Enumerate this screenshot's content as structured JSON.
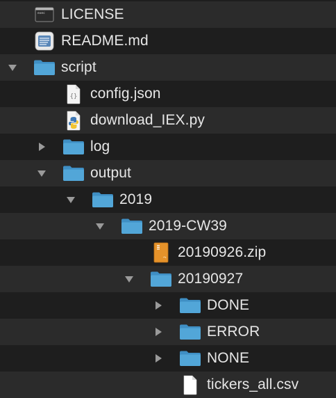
{
  "tree": [
    {
      "label": "LICENSE",
      "type": "file",
      "icon": "exec-document-icon",
      "depth": 0,
      "disclosure": "none"
    },
    {
      "label": "README.md",
      "type": "file",
      "icon": "markdown-document-icon",
      "depth": 0,
      "disclosure": "none"
    },
    {
      "label": "script",
      "type": "folder",
      "icon": "folder-icon",
      "depth": 0,
      "disclosure": "expanded"
    },
    {
      "label": "config.json",
      "type": "file",
      "icon": "json-document-icon",
      "depth": 1,
      "disclosure": "none"
    },
    {
      "label": "download_IEX.py",
      "type": "file",
      "icon": "python-document-icon",
      "depth": 1,
      "disclosure": "none"
    },
    {
      "label": "log",
      "type": "folder",
      "icon": "folder-icon",
      "depth": 1,
      "disclosure": "collapsed"
    },
    {
      "label": "output",
      "type": "folder",
      "icon": "folder-icon",
      "depth": 1,
      "disclosure": "expanded"
    },
    {
      "label": "2019",
      "type": "folder",
      "icon": "folder-icon",
      "depth": 2,
      "disclosure": "expanded"
    },
    {
      "label": "2019-CW39",
      "type": "folder",
      "icon": "folder-icon",
      "depth": 3,
      "disclosure": "expanded"
    },
    {
      "label": "20190926.zip",
      "type": "file",
      "icon": "zip-archive-icon",
      "depth": 4,
      "disclosure": "none"
    },
    {
      "label": "20190927",
      "type": "folder",
      "icon": "folder-icon",
      "depth": 4,
      "disclosure": "expanded"
    },
    {
      "label": "DONE",
      "type": "folder",
      "icon": "folder-icon",
      "depth": 5,
      "disclosure": "collapsed"
    },
    {
      "label": "ERROR",
      "type": "folder",
      "icon": "folder-icon",
      "depth": 5,
      "disclosure": "collapsed"
    },
    {
      "label": "NONE",
      "type": "folder",
      "icon": "folder-icon",
      "depth": 5,
      "disclosure": "collapsed"
    },
    {
      "label": "tickers_all.csv",
      "type": "file",
      "icon": "csv-document-icon",
      "depth": 5,
      "disclosure": "none"
    }
  ],
  "colors": {
    "background": "#1e1e1e",
    "alternate_row": "#2b2b2b",
    "text": "#e6e6e6",
    "folder": "#52a6d8",
    "folder_tab": "#3f8fc4",
    "disclosure": "#9a9a9a"
  }
}
